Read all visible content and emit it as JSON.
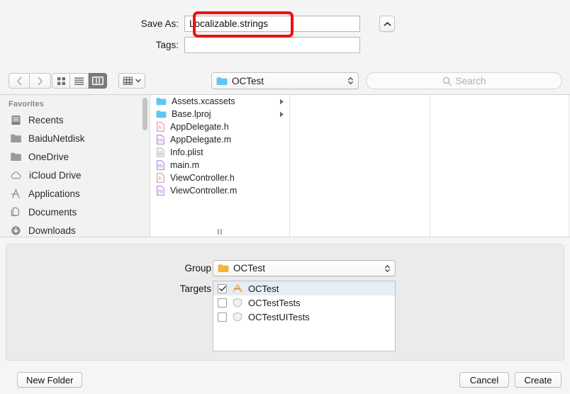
{
  "save_panel": {
    "save_as": {
      "label": "Save As:",
      "value": "Localizable.strings",
      "icon": "text-input"
    },
    "tags": {
      "label": "Tags:",
      "value": "",
      "placeholder": ""
    },
    "expand_button_icon": "chevron-up-icon",
    "annotation": {
      "color": "#ee1111",
      "target": "save-as-field"
    }
  },
  "toolbar": {
    "back_icon": "chevron-left-icon",
    "forward_icon": "chevron-right-icon",
    "view_modes": [
      {
        "name": "icon-view",
        "icon": "grid-icon",
        "active": false
      },
      {
        "name": "list-view",
        "icon": "list-icon",
        "active": false
      },
      {
        "name": "column-view",
        "icon": "columns-icon",
        "active": true
      }
    ],
    "group_by": {
      "icon": "group-icon",
      "chevron": "chevron-down-icon"
    },
    "path_popup": {
      "label": "OCTest",
      "icon": "folder-icon"
    },
    "search": {
      "placeholder": "Search",
      "icon": "search-icon",
      "value": ""
    }
  },
  "sidebar": {
    "header": "Favorites",
    "items": [
      {
        "label": "Recents",
        "icon": "recents-icon"
      },
      {
        "label": "BaiduNetdisk",
        "icon": "folder-icon"
      },
      {
        "label": "OneDrive",
        "icon": "folder-icon"
      },
      {
        "label": "iCloud Drive",
        "icon": "cloud-icon"
      },
      {
        "label": "Applications",
        "icon": "applications-icon"
      },
      {
        "label": "Documents",
        "icon": "documents-icon"
      },
      {
        "label": "Downloads",
        "icon": "downloads-icon"
      }
    ]
  },
  "browser": {
    "column1": [
      {
        "label": "Assets.xcassets",
        "icon": "folder-icon",
        "has_children": true
      },
      {
        "label": "Base.lproj",
        "icon": "folder-icon",
        "has_children": true
      },
      {
        "label": "AppDelegate.h",
        "icon": "header-file-icon",
        "has_children": false
      },
      {
        "label": "AppDelegate.m",
        "icon": "source-file-icon",
        "has_children": false
      },
      {
        "label": "Info.plist",
        "icon": "plist-file-icon",
        "has_children": false
      },
      {
        "label": "main.m",
        "icon": "source-file-icon",
        "has_children": false
      },
      {
        "label": "ViewController.h",
        "icon": "header-file-icon",
        "has_children": false
      },
      {
        "label": "ViewController.m",
        "icon": "source-file-icon",
        "has_children": false
      }
    ]
  },
  "accessory": {
    "group": {
      "label": "Group",
      "value": "OCTest",
      "icon": "folder-icon"
    },
    "targets": {
      "label": "Targets",
      "items": [
        {
          "label": "OCTest",
          "checked": true,
          "selected": true,
          "icon": "xcode-app-icon"
        },
        {
          "label": "OCTestTests",
          "checked": false,
          "selected": false,
          "icon": "test-bundle-icon"
        },
        {
          "label": "OCTestUITests",
          "checked": false,
          "selected": false,
          "icon": "test-bundle-icon"
        }
      ]
    }
  },
  "buttons": {
    "new_folder": "New Folder",
    "cancel": "Cancel",
    "create": "Create"
  },
  "colors": {
    "accent_folder": "#5ec7f0",
    "group_folder": "#f2b636",
    "annotation_red": "#ee1111",
    "selection": "#e6edf4",
    "header_file": "#e0849c",
    "source_file": "#9a7fd0"
  }
}
